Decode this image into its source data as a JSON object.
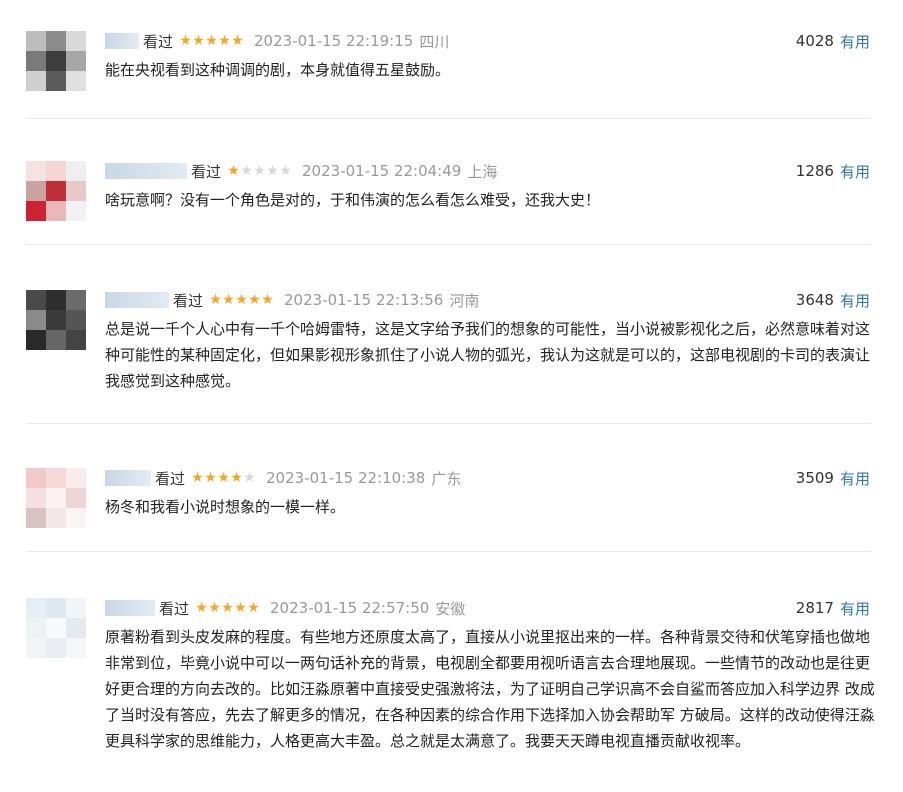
{
  "reviews": [
    {
      "seen": "看过",
      "rating": 5,
      "time": "2023-01-15 22:19:15",
      "location": "四川",
      "votes": "4028",
      "useful_label": "有用",
      "content": "能在央视看到这种调调的剧，本身就值得五星鼓励。",
      "avatar_colors": [
        "#bdbdbd",
        "#8c8c8c",
        "#d9d9d9",
        "#7a7a7a",
        "#3d3d3d",
        "#a6a6a6",
        "#cfcfcf",
        "#5c5c5c",
        "#e0e0e0"
      ]
    },
    {
      "seen": "看过",
      "rating": 1,
      "time": "2023-01-15 22:04:49",
      "location": "上海",
      "votes": "1286",
      "useful_label": "有用",
      "content": "啥玩意啊？没有一个角色是对的，于和伟演的怎么看怎么难受，还我大史！",
      "avatar_colors": [
        "#f3e3e3",
        "#f7d5d5",
        "#efefef",
        "#c9a2a2",
        "#c0303a",
        "#e7c9c9",
        "#cc2233",
        "#e9b8b8",
        "#f1f1f1"
      ]
    },
    {
      "seen": "看过",
      "rating": 5,
      "time": "2023-01-15 22:13:56",
      "location": "河南",
      "votes": "3648",
      "useful_label": "有用",
      "content": "总是说一千个人心中有一千个哈姆雷特，这是文字给予我们的想象的可能性，当小说被影视化之后，必然意味着对这种可能性的某种固定化，但如果影视形象抓住了小说人物的弧光，我认为这就是可以的，这部电视剧的卡司的表演让我感觉到这种感觉。",
      "avatar_colors": [
        "#4a4a4a",
        "#2e2e2e",
        "#6b6b6b",
        "#8a8a8a",
        "#3a3a3a",
        "#555555",
        "#2a2a2a",
        "#666666",
        "#444444"
      ]
    },
    {
      "seen": "看过",
      "rating": 4,
      "time": "2023-01-15 22:10:38",
      "location": "广东",
      "votes": "3509",
      "useful_label": "有用",
      "content": "杨冬和我看小说时想象的一模一样。",
      "avatar_colors": [
        "#f2c9c9",
        "#f6dada",
        "#f8eded",
        "#f4e0e0",
        "#fbf3f3",
        "#eed6d6",
        "#d9c2c2",
        "#f3e7e7",
        "#faf4f4"
      ]
    },
    {
      "seen": "看过",
      "rating": 5,
      "time": "2023-01-15 22:57:50",
      "location": "安徽",
      "votes": "2817",
      "useful_label": "有用",
      "content": "原著粉看到头皮发麻的程度。有些地方还原度太高了，直接从小说里抠出来的一样。各种背景交待和伏笔穿插也做地非常到位，毕竟小说中可以一两句话补充的背景，电视剧全都要用视听语言去合理地展现。一些情节的改动也是往更好更合理的方向去改的。比如汪淼原著中直接受史强激将法，为了证明自己学识高不会自鲨而答应加入科学边界 改成了当时没有答应，先去了解更多的情况，在各种因素的综合作用下选择加入协会帮助军 方破局。这样的改动使得汪淼更具科学家的思维能力，人格更高大丰盈。总之就是太满意了。我要天天蹲电视直播贡献收视率。",
      "avatar_colors": [
        "#e7eef3",
        "#dfe8ef",
        "#f2f5f8",
        "#eef2f5",
        "#f7f9fa",
        "#e4ebf0",
        "#f0f4f6",
        "#e9eef2",
        "#f5f7f9"
      ]
    }
  ]
}
